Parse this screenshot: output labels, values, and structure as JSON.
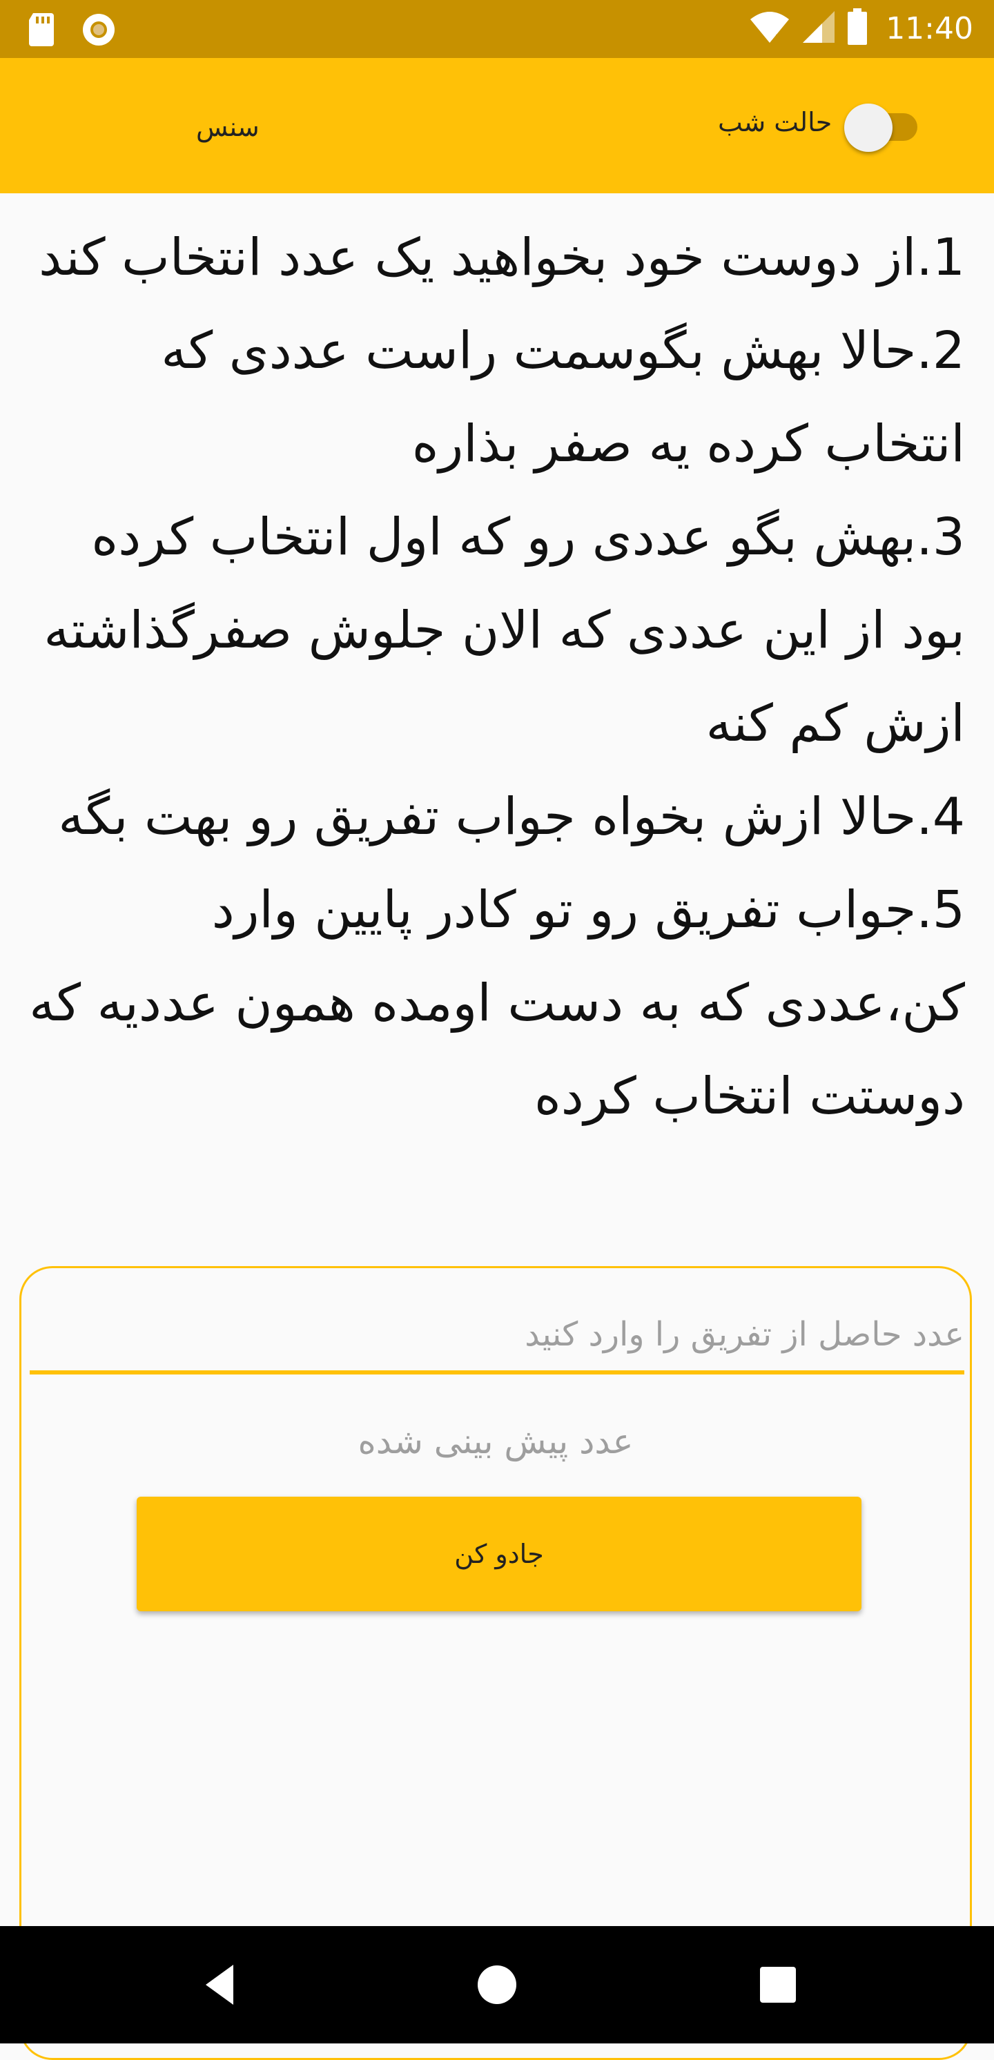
{
  "status_bar": {
    "time": "11:40",
    "icons": [
      "sd-card-icon",
      "circle-notification-icon",
      "wifi-icon",
      "signal-icon",
      "battery-icon"
    ]
  },
  "app_bar": {
    "title": "سنس",
    "night_mode_label": "حالت شب",
    "night_mode_on": false
  },
  "instructions": {
    "steps": [
      "1.از دوست خود بخواهید یک عدد انتخاب کند",
      "2.حالا بهش بگوسمت راست عددی که انتخاب کرده یه صفر بذاره",
      "3.بهش بگو عددی رو که اول انتخاب کرده بود از این عددی که الان جلوش صفرگذاشته ازش کم کنه",
      "4.حالا ازش بخواه جواب تفریق رو بهت بگه",
      "5.جواب تفریق رو تو کادر پایین وارد کن،عددی که به دست اومده همون عددیه که دوستت انتخاب کرده"
    ]
  },
  "card": {
    "input_placeholder": "عدد حاصل از تفریق را وارد کنید",
    "input_value": "",
    "prediction_text": "عدد پیش بینی شده",
    "button_label": "جادو کن"
  },
  "colors": {
    "accent": "#FFC107",
    "status_bar": "#C79100",
    "background": "#FAFAFA"
  },
  "nav_bar": {
    "icons": [
      "back-icon",
      "home-icon",
      "recents-icon"
    ]
  }
}
